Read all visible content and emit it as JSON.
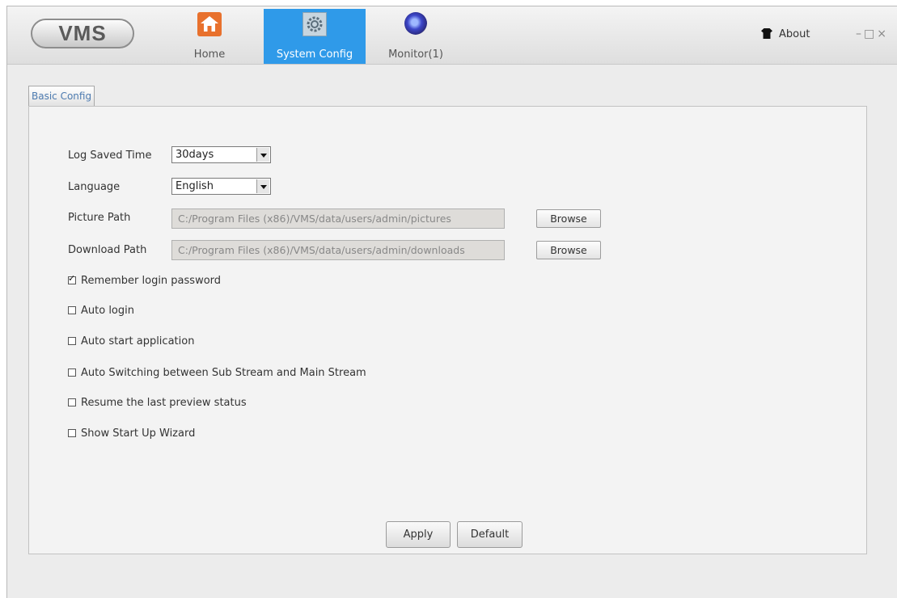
{
  "app": {
    "logo": "VMS"
  },
  "nav": {
    "tabs": [
      {
        "label": "Home",
        "icon": "home-icon",
        "active": false
      },
      {
        "label": "System Config",
        "icon": "gear-icon",
        "active": true
      },
      {
        "label": "Monitor(1)",
        "icon": "monitor-icon",
        "active": false
      }
    ]
  },
  "header": {
    "about_label": "About",
    "about_icon": "shirt-icon",
    "window_controls": "–□×"
  },
  "subtabs": [
    {
      "label": "Basic Config",
      "active": true
    }
  ],
  "form": {
    "log_saved_time": {
      "label": "Log Saved Time",
      "value": "30days"
    },
    "language": {
      "label": "Language",
      "value": "English"
    },
    "picture_path": {
      "label": "Picture Path",
      "value": "C:/Program Files (x86)/VMS/data/users/admin/pictures",
      "button": "Browse"
    },
    "download_path": {
      "label": "Download Path",
      "value": "C:/Program Files (x86)/VMS/data/users/admin/downloads",
      "button": "Browse"
    },
    "checkboxes": [
      {
        "label": "Remember login password",
        "checked": true
      },
      {
        "label": "Auto login",
        "checked": false
      },
      {
        "label": "Auto start application",
        "checked": false
      },
      {
        "label": "Auto Switching between Sub Stream and Main Stream",
        "checked": false
      },
      {
        "label": "Resume the last preview status",
        "checked": false
      },
      {
        "label": "Show Start Up Wizard",
        "checked": false
      }
    ]
  },
  "actions": {
    "apply_label": "Apply",
    "default_label": "Default"
  },
  "colors": {
    "accent": "#2f9ae9",
    "home_icon": "#e8712d"
  }
}
